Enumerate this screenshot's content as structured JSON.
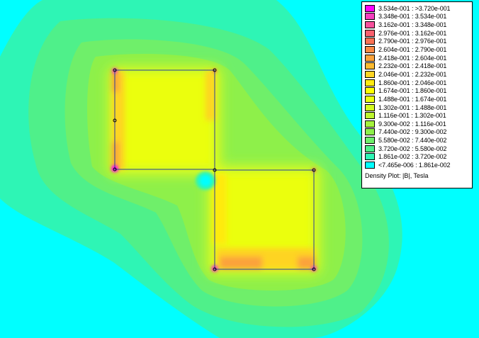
{
  "legend": {
    "caption": "Density Plot: |B|, Tesla",
    "rows": [
      {
        "range": "3.534e-001 : >3.720e-001",
        "color": "#ff00ff"
      },
      {
        "range": "3.348e-001 : 3.534e-001",
        "color": "#f53fbf"
      },
      {
        "range": "3.162e-001 : 3.348e-001",
        "color": "#f64f9c"
      },
      {
        "range": "2.976e-001 : 3.162e-001",
        "color": "#f9606e"
      },
      {
        "range": "2.790e-001 : 2.976e-001",
        "color": "#fa7254"
      },
      {
        "range": "2.604e-001 : 2.790e-001",
        "color": "#fb8a44"
      },
      {
        "range": "2.418e-001 : 2.604e-001",
        "color": "#fca23a"
      },
      {
        "range": "2.232e-001 : 2.418e-001",
        "color": "#fdbb30"
      },
      {
        "range": "2.046e-001 : 2.232e-001",
        "color": "#fed424"
      },
      {
        "range": "1.860e-001 : 2.046e-001",
        "color": "#ffea10"
      },
      {
        "range": "1.674e-001 : 1.860e-001",
        "color": "#ffff00"
      },
      {
        "range": "1.488e-001 : 1.674e-001",
        "color": "#ebff10"
      },
      {
        "range": "1.302e-001 : 1.488e-001",
        "color": "#d4fb1f"
      },
      {
        "range": "1.116e-001 : 1.302e-001",
        "color": "#bdf52e"
      },
      {
        "range": "9.300e-002 : 1.116e-001",
        "color": "#a5f23c"
      },
      {
        "range": "7.440e-002 : 9.300e-002",
        "color": "#8ef04a"
      },
      {
        "range": "5.580e-002 : 7.440e-002",
        "color": "#6fef6a"
      },
      {
        "range": "3.720e-002 : 5.580e-002",
        "color": "#4ff08a"
      },
      {
        "range": "1.861e-002 : 3.720e-002",
        "color": "#2ef5b5"
      },
      {
        "range": "<7.465e-006 : 1.861e-002",
        "color": "#00ffff"
      }
    ]
  }
}
